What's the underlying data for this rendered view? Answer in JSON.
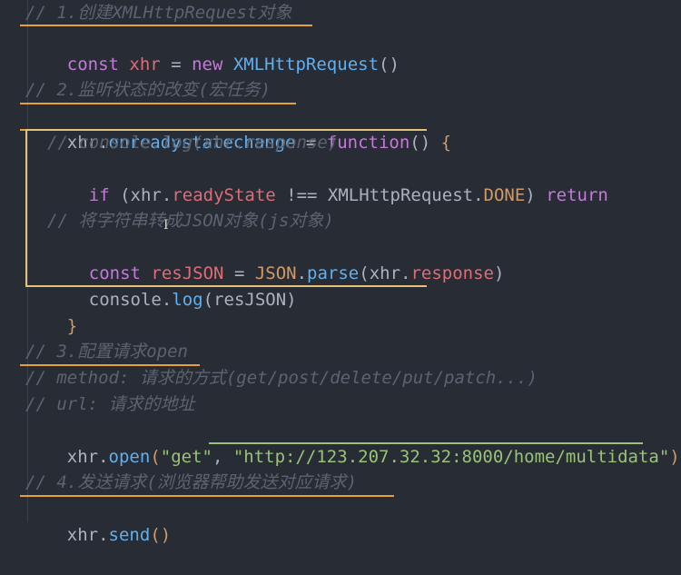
{
  "lines": {
    "l1": "// 1.创建XMLHttpRequest对象",
    "l2_kw": "const",
    "l2_var": "xhr",
    "l2_eq": " = ",
    "l2_new": "new",
    "l2_cls": "XMLHttpRequest",
    "l2_paren": "()",
    "l4": "// 2.监听状态的改变(宏任务)",
    "l5_obj": "xhr",
    "l5_dot": ".",
    "l5_prop": "onreadystatechange",
    "l5_eq": " = ",
    "l5_fn": "function",
    "l5_paren": "() ",
    "l5_brace": "{",
    "l6": "// console.log(xhr.response)",
    "l7_if": "if",
    "l7_open": " (",
    "l7_obj": "xhr",
    "l7_dot": ".",
    "l7_prop": "readyState",
    "l7_op": " !== ",
    "l7_cls": "XMLHttpRequest",
    "l7_dot2": ".",
    "l7_done": "DONE",
    "l7_close": ") ",
    "l7_ret": "return",
    "l9": "// 将字符串转成JSON对象(js对象)",
    "l10_kw": "const",
    "l10_var": "resJSON",
    "l10_eq": " = ",
    "l10_cls": "JSON",
    "l10_dot": ".",
    "l10_fn": "parse",
    "l10_open": "(",
    "l10_obj": "xhr",
    "l10_dot2": ".",
    "l10_prop": "response",
    "l10_close": ")",
    "l11_obj": "console",
    "l11_dot": ".",
    "l11_fn": "log",
    "l11_open": "(",
    "l11_arg": "resJSON",
    "l11_close": ")",
    "l12_brace": "}",
    "l14": "// 3.配置请求open",
    "l15": "// method: 请求的方式(get/post/delete/put/patch...)",
    "l16": "// url: 请求的地址",
    "l17_obj": "xhr",
    "l17_dot": ".",
    "l17_fn": "open",
    "l17_open": "(",
    "l17_s1": "\"get\"",
    "l17_comma": ", ",
    "l17_s2": "\"http://123.207.32.32:8000/home/multidata\"",
    "l17_close": ")",
    "l19": "// 4.发送请求(浏览器帮助发送对应请求)",
    "l20_obj": "xhr",
    "l20_dot": ".",
    "l20_fn": "send",
    "l20_paren": "()"
  },
  "cursor_glyph": "I",
  "colors": {
    "background": "#282c34",
    "comment": "#5c6370",
    "keyword": "#c678dd",
    "variable": "#e06c75",
    "function": "#61afef",
    "string": "#98c379",
    "highlight_underline": "#e5a23b",
    "block_box": "#e5c07b"
  }
}
